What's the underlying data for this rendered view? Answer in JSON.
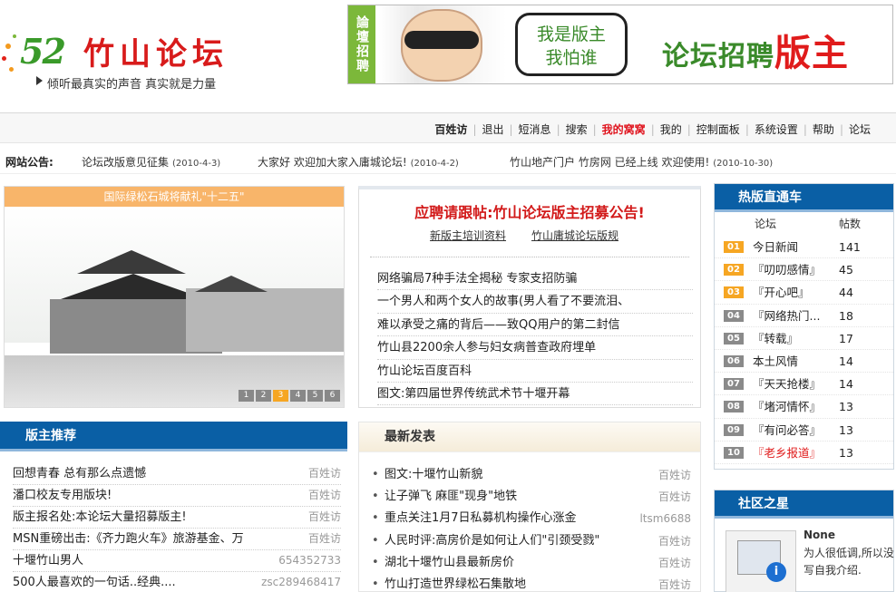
{
  "header": {
    "logo_num": "52",
    "logo_name": "竹山论坛",
    "slogan": "倾听最真实的声音 真实就是力量",
    "banner": {
      "side": "論壇招聘",
      "bubble_line1": "我是版主",
      "bubble_line2": "我怕谁",
      "big_text": "论坛招聘",
      "big_red": "版主"
    }
  },
  "nav": {
    "items": [
      {
        "label": "百姓访",
        "style": "b"
      },
      {
        "label": "退出",
        "style": ""
      },
      {
        "label": "短消息",
        "style": ""
      },
      {
        "label": "搜索",
        "style": ""
      },
      {
        "label": "我的窝窝",
        "style": "r"
      },
      {
        "label": "我的",
        "style": ""
      },
      {
        "label": "控制面板",
        "style": ""
      },
      {
        "label": "系统设置",
        "style": ""
      },
      {
        "label": "帮助",
        "style": ""
      },
      {
        "label": "论坛",
        "style": ""
      }
    ]
  },
  "notice": {
    "label": "网站公告:",
    "items": [
      {
        "text": "论坛改版意见征集",
        "date": "(2010-4-3)"
      },
      {
        "text": "大家好 欢迎加大家入庸城论坛!",
        "date": "(2010-4-2)"
      },
      {
        "text": "竹山地产门户 竹房网 已经上线 欢迎使用!",
        "date": "(2010-10-30)"
      }
    ]
  },
  "slideshow": {
    "caption": "国际绿松石城将献礼\"十二五\"",
    "pages": [
      "1",
      "2",
      "3",
      "4",
      "5",
      "6"
    ],
    "active_page": "3"
  },
  "announce": {
    "title": "应聘请跟帖:竹山论坛版主招募公告!",
    "sub_links": [
      "新版主培训资料",
      "竹山庸城论坛版规"
    ],
    "list": [
      "网络骗局7种手法全揭秘 专家支招防骗",
      "一个男人和两个女人的故事(男人看了不要流泪、",
      "难以承受之痛的背后——致QQ用户的第二封信",
      "竹山县2200余人参与妇女病普查政府埋单",
      "竹山论坛百度百科",
      "图文:第四届世界传统武术节十堰开幕"
    ]
  },
  "hot": {
    "title": "热版直通车",
    "col_forum": "论坛",
    "col_posts": "帖数",
    "rows": [
      {
        "num": "01",
        "forum": "今日新闻",
        "count": "141",
        "top": true,
        "red": false
      },
      {
        "num": "02",
        "forum": "『叨叨感情』",
        "count": "45",
        "top": true,
        "red": false
      },
      {
        "num": "03",
        "forum": "『开心吧』",
        "count": "44",
        "top": true,
        "red": false
      },
      {
        "num": "04",
        "forum": "『网络热门...",
        "count": "18",
        "top": false,
        "red": false
      },
      {
        "num": "05",
        "forum": "『转载』",
        "count": "17",
        "top": false,
        "red": false
      },
      {
        "num": "06",
        "forum": "本土风情",
        "count": "14",
        "top": false,
        "red": false
      },
      {
        "num": "07",
        "forum": "『天天抢楼』",
        "count": "14",
        "top": false,
        "red": false
      },
      {
        "num": "08",
        "forum": "『堵河情怀』",
        "count": "13",
        "top": false,
        "red": false
      },
      {
        "num": "09",
        "forum": "『有问必答』",
        "count": "13",
        "top": false,
        "red": false
      },
      {
        "num": "10",
        "forum": "『老乡报道』",
        "count": "13",
        "top": false,
        "red": true
      }
    ]
  },
  "star": {
    "title": "社区之星",
    "name": "None",
    "desc": "为人很低调,所以没写自我介绍."
  },
  "mods": {
    "title": "版主推荐",
    "list": [
      {
        "title": "回想青春 总有那么点遗憾",
        "user": "百姓访"
      },
      {
        "title": "潘口校友专用版块!",
        "user": "百姓访"
      },
      {
        "title": "版主报名处:本论坛大量招募版主!",
        "user": "百姓访"
      },
      {
        "title": "MSN重磅出击:《齐力跑火车》旅游基金、万",
        "user": "百姓访"
      },
      {
        "title": "十堰竹山男人",
        "user": "654352733"
      },
      {
        "title": "500人最喜欢的一句话..经典....",
        "user": "zsc289468417"
      }
    ]
  },
  "latest": {
    "title": "最新发表",
    "list": [
      {
        "title": "图文:十堰竹山新貌",
        "user": "百姓访"
      },
      {
        "title": "让子弹飞 麻匪\"现身\"地铁",
        "user": "百姓访"
      },
      {
        "title": "重点关注1月7日私募机构操作心涨金",
        "user": "ltsm6688"
      },
      {
        "title": "人民时评:高房价是如何让人们\"引颈受戮\"",
        "user": "百姓访"
      },
      {
        "title": "湖北十堰竹山县最新房价",
        "user": "百姓访"
      },
      {
        "title": "竹山打造世界绿松石集散地",
        "user": "百姓访"
      }
    ]
  },
  "colors": {
    "brand_blue": "#0a5fa5",
    "brand_red": "#d21a1a",
    "accent_orange": "#f6a623"
  }
}
